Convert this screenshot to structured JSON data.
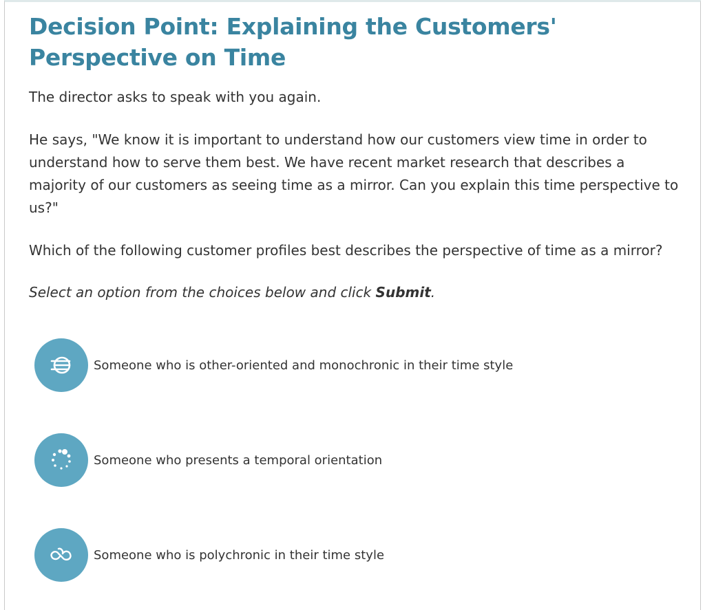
{
  "page": {
    "title": "Decision Point: Explaining the Customers' Perspective on Time",
    "intro": "The director asks to speak with you again.",
    "quote": "He says, \"We know it is important to understand how our customers view time in order to understand how to serve them best. We have recent market research that describes a majority of our customers as seeing time as a mirror. Can you explain this time perspective to us?\"",
    "question": "Which of the following customer profiles best describes the perspective of time as a mirror?",
    "instruction_prefix": "Select an option from the choices below and click ",
    "instruction_action": "Submit",
    "instruction_suffix": "."
  },
  "options": [
    {
      "icon": "striped-globe-icon",
      "label": "Someone who is other-oriented and monochronic in their time style"
    },
    {
      "icon": "dotted-circle-icon",
      "label": "Someone who presents a temporal orientation"
    },
    {
      "icon": "infinity-cloud-icon",
      "label": "Someone who is polychronic in their time style"
    }
  ],
  "colors": {
    "title": "#3a84a0",
    "icon_bg": "#5ea7c2",
    "text": "#333333"
  }
}
